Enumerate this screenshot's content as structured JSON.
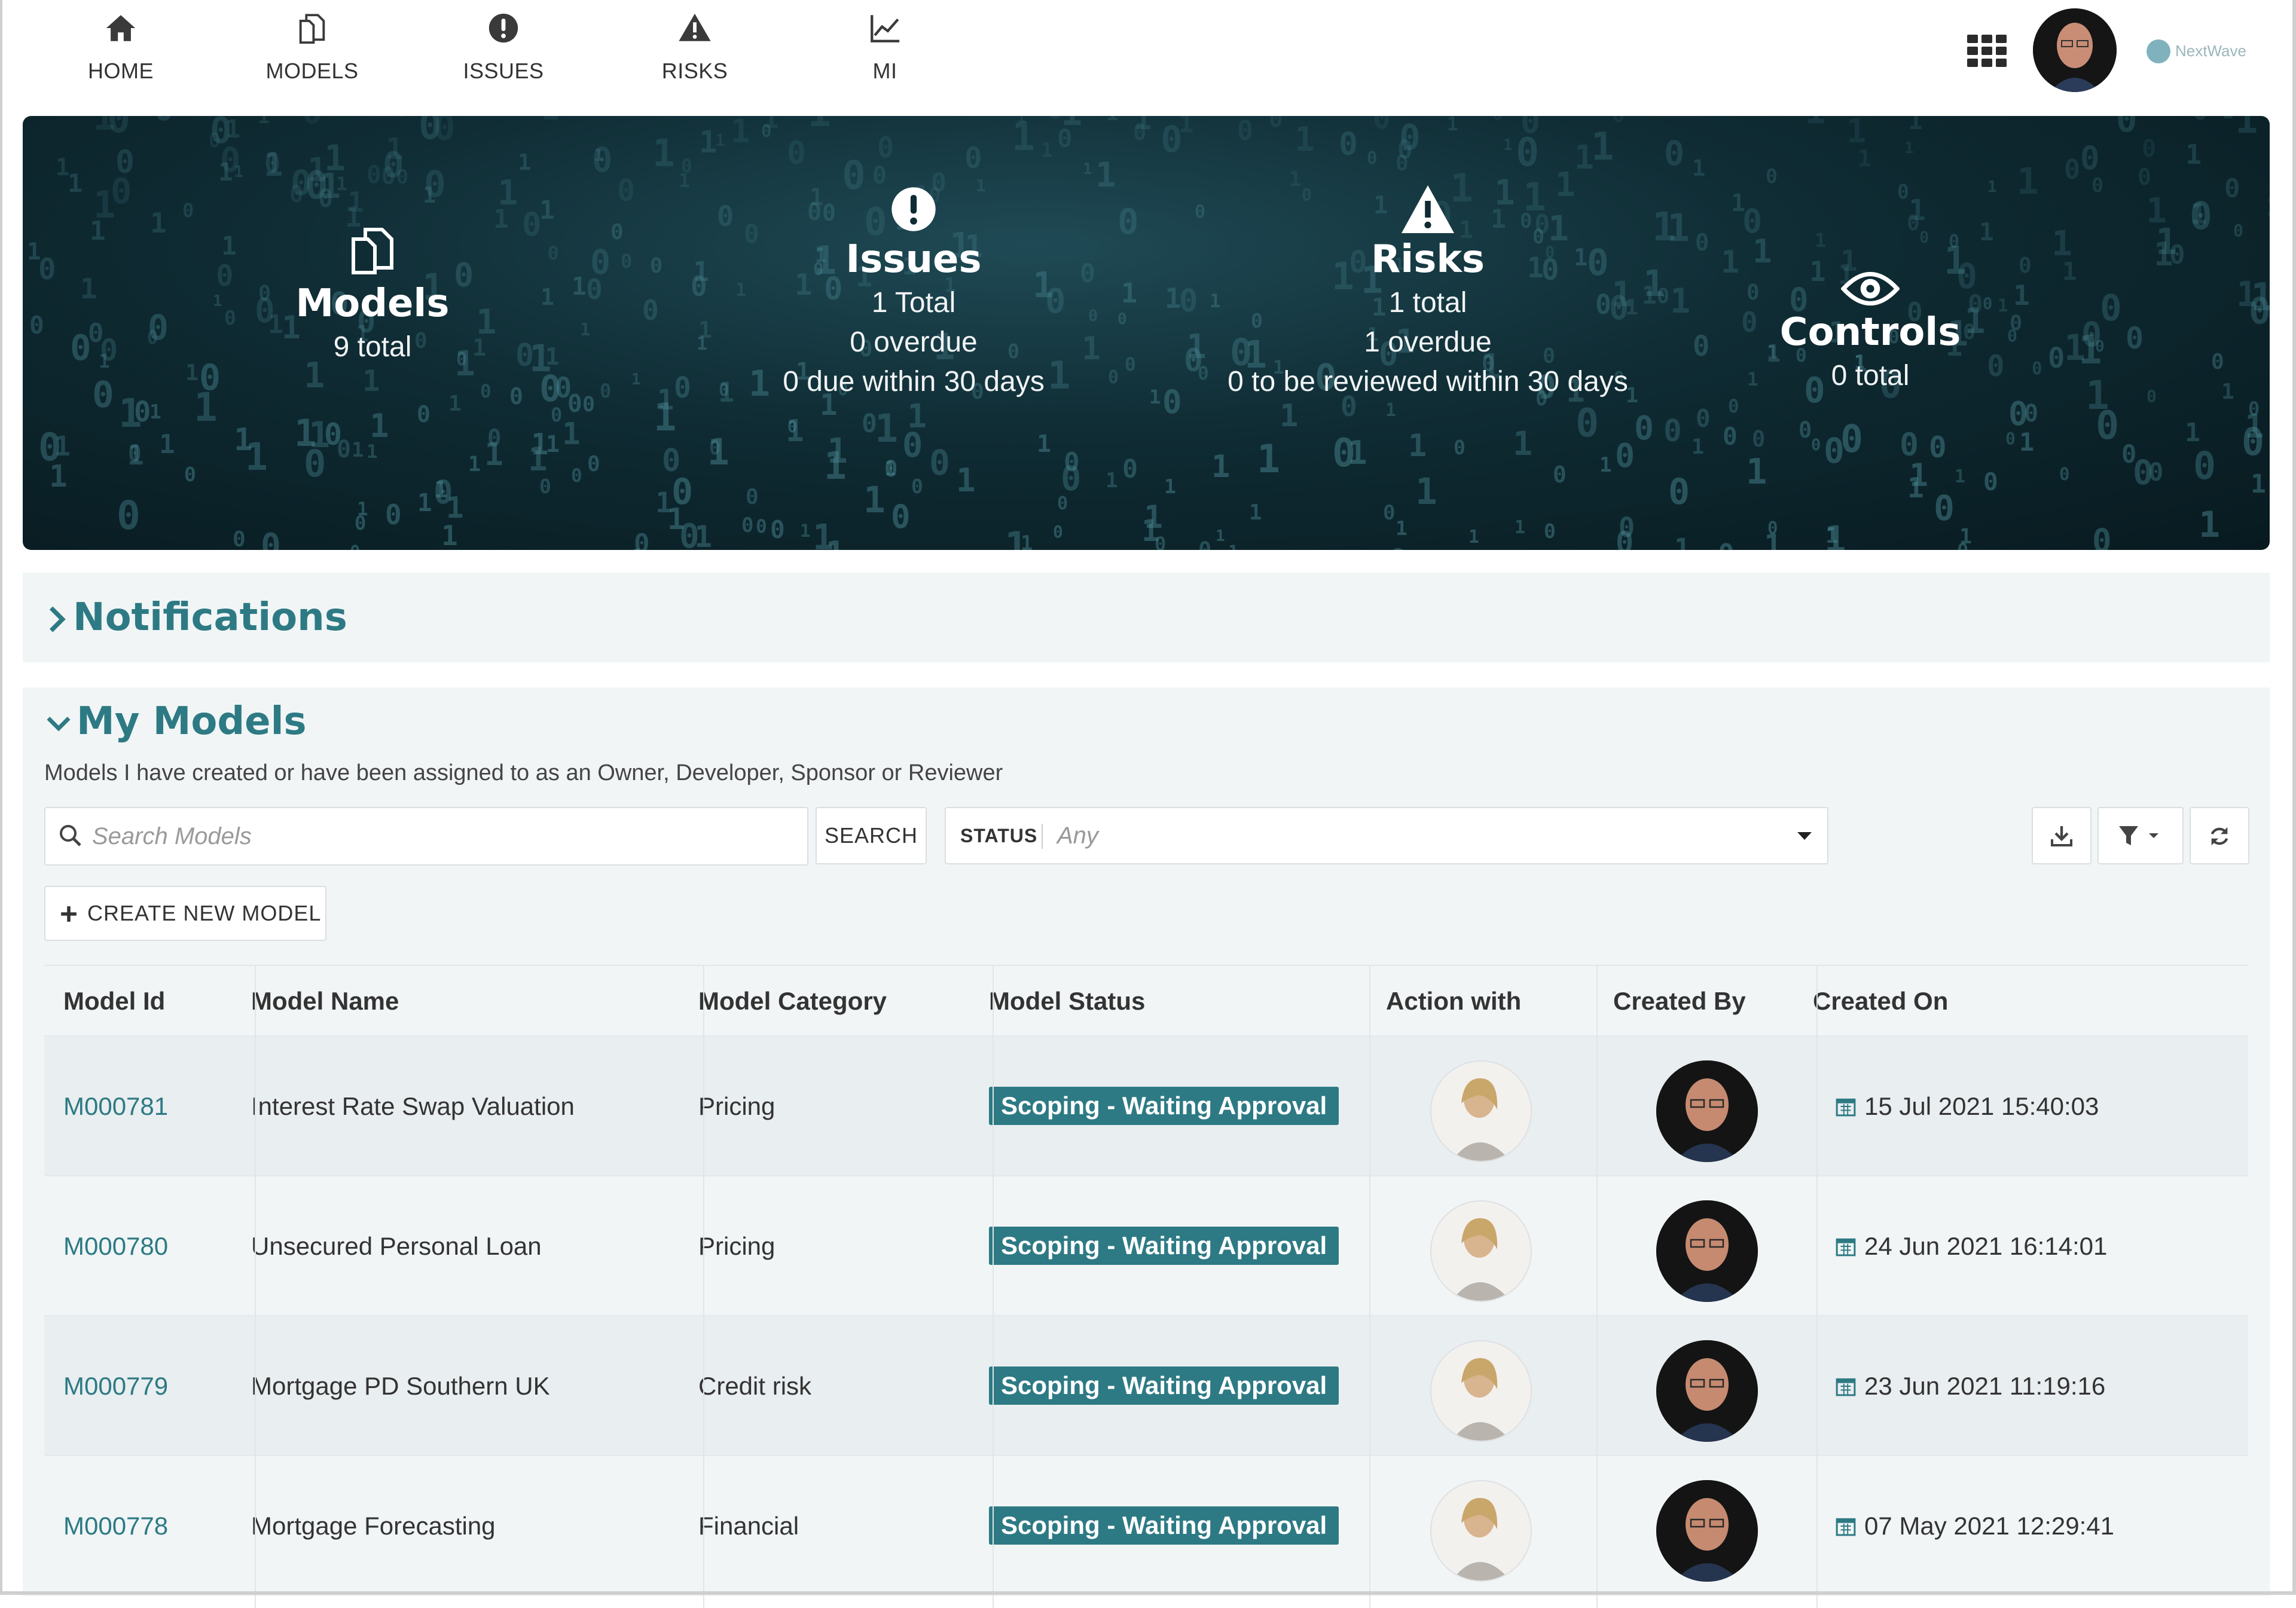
{
  "nav": {
    "items": [
      {
        "label": "HOME",
        "icon": "home-icon"
      },
      {
        "label": "MODELS",
        "icon": "models-icon"
      },
      {
        "label": "ISSUES",
        "icon": "issues-icon"
      },
      {
        "label": "RISKS",
        "icon": "risks-icon"
      },
      {
        "label": "MI",
        "icon": "chart-icon"
      }
    ],
    "brand": "NextWave",
    "accent": "#2d7a84"
  },
  "summary": {
    "models": {
      "title": "Models",
      "lines": [
        "9 total"
      ]
    },
    "issues": {
      "title": "Issues",
      "lines": [
        "1 Total",
        "0 overdue",
        "0 due within 30 days"
      ]
    },
    "risks": {
      "title": "Risks",
      "lines": [
        "1 total",
        "1 overdue",
        "0 to be reviewed within 30 days"
      ]
    },
    "controls": {
      "title": "Controls",
      "lines": [
        "0 total"
      ]
    }
  },
  "notifications": {
    "title": "Notifications"
  },
  "my_models": {
    "title": "My Models",
    "description": "Models I have created or have been assigned to as an Owner, Developer, Sponsor or Reviewer",
    "search_placeholder": "Search Models",
    "search_button": "SEARCH",
    "status_label": "STATUS",
    "status_value": "Any",
    "create_button": "CREATE NEW MODEL",
    "columns": [
      "Model Id",
      "Model Name",
      "Model Category",
      "Model Status",
      "Action with",
      "Created By",
      "Created On"
    ],
    "rows": [
      {
        "id": "M000781",
        "name": "Interest Rate Swap Valuation",
        "category": "Pricing",
        "status": "Scoping - Waiting Approval",
        "created_on": "15 Jul 2021 15:40:03"
      },
      {
        "id": "M000780",
        "name": "Unsecured Personal Loan",
        "category": "Pricing",
        "status": "Scoping - Waiting Approval",
        "created_on": "24 Jun 2021 16:14:01"
      },
      {
        "id": "M000779",
        "name": "Mortgage PD Southern UK",
        "category": "Credit risk",
        "status": "Scoping - Waiting Approval",
        "created_on": "23 Jun 2021 11:19:16"
      },
      {
        "id": "M000778",
        "name": "Mortgage Forecasting",
        "category": "Financial",
        "status": "Scoping - Waiting Approval",
        "created_on": "07 May 2021 12:29:41"
      }
    ]
  }
}
